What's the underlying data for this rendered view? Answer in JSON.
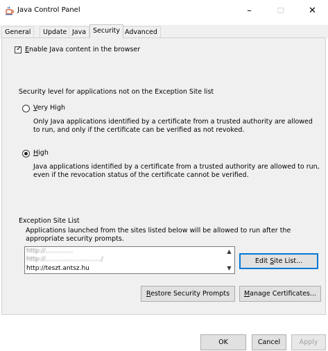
{
  "window": {
    "title": "Java Control Panel",
    "minimize_glyph": "–",
    "maximize_glyph": "☐",
    "close_glyph": "✕"
  },
  "tabs": [
    {
      "label": "General",
      "active": false
    },
    {
      "label": "Update",
      "active": false
    },
    {
      "label": "Java",
      "active": false
    },
    {
      "label": "Security",
      "active": true
    },
    {
      "label": "Advanced",
      "active": false
    }
  ],
  "security": {
    "enable_checkbox": {
      "checked": true,
      "prefix": "E",
      "rest": "nable Java content in the browser"
    },
    "level_heading": "Security level for applications not on the Exception Site list",
    "very_high": {
      "selected": false,
      "prefix": "V",
      "rest": "ery High",
      "description": "Only Java applications identified by a certificate from a trusted authority are allowed to run, and only if the certificate can be verified as not revoked."
    },
    "high": {
      "selected": true,
      "prefix": "H",
      "rest": "igh",
      "description": "Java applications identified by a certificate from a trusted authority are allowed to run, even if the revocation status of the certificate cannot be verified."
    },
    "exception_heading": "Exception Site List",
    "exception_description": "Applications launched from the sites listed below will be allowed to run after the appropriate security prompts.",
    "exception_sites": [
      "http://..............",
      "http://............................/",
      "http://teszt.antsz.hu"
    ],
    "edit_button": {
      "before": "Edit ",
      "accel": "S",
      "after": "ite List..."
    },
    "restore_button": {
      "before": "",
      "accel": "R",
      "after": "estore Security Prompts"
    },
    "manage_button": {
      "before": "",
      "accel": "M",
      "after": "anage Certificates..."
    }
  },
  "footer": {
    "ok": "OK",
    "cancel": "Cancel",
    "apply": "Apply"
  }
}
